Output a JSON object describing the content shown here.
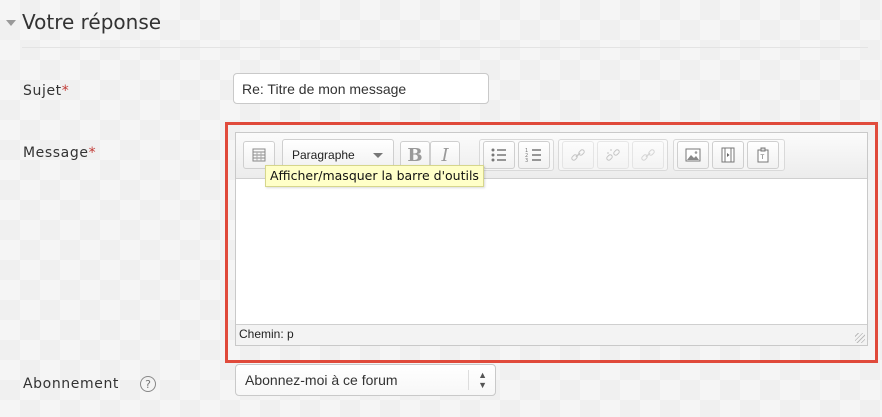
{
  "section": {
    "title": "Votre réponse",
    "collapse_icon": "chevron-down-icon"
  },
  "subject": {
    "label": "Sujet",
    "required_mark": "*",
    "value": "Re: Titre de mon message"
  },
  "message": {
    "label": "Message",
    "required_mark": "*",
    "toolbar": {
      "toggle_icon": "toolbar-toggle-icon",
      "format_select": "Paragraphe",
      "bold": "B",
      "italic": "I",
      "icons": [
        "bullet-list-icon",
        "numbered-list-icon",
        "link-icon",
        "unlink-icon",
        "anchor-icon",
        "image-icon",
        "media-icon",
        "paste-text-icon"
      ]
    },
    "tooltip": "Afficher/masquer la barre d'outils",
    "statusbar_path": "Chemin: p",
    "highlight_color": "#e04a3b"
  },
  "subscription": {
    "label": "Abonnement",
    "help_icon": "?",
    "selected": "Abonnez-moi à ce forum"
  }
}
